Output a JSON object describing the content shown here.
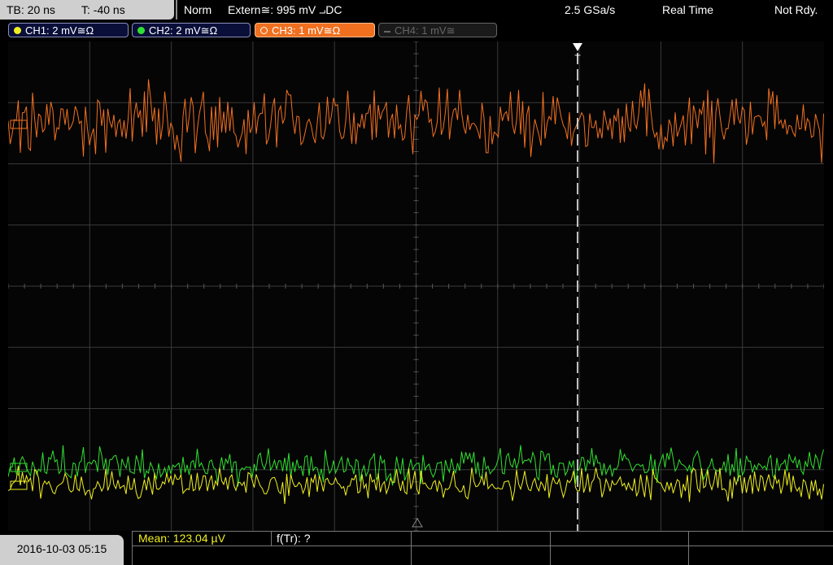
{
  "header": {
    "tb_label": "TB: 20 ns",
    "trig_offset": "T: -40 ns",
    "mode": "Norm",
    "trigger": "Extern≅: 995 mV ⨼DC",
    "sample_rate": "2.5 GSa/s",
    "acq_mode": "Real Time",
    "status": "Not Rdy."
  },
  "channels": [
    {
      "label": "CH1: 2 mV≅Ω",
      "color": "#f0f020",
      "state": "on"
    },
    {
      "label": "CH2: 2 mV≅Ω",
      "color": "#30e030",
      "state": "on"
    },
    {
      "label": "CH3: 1 mV≅Ω",
      "color": "#f07020",
      "state": "active"
    },
    {
      "label": "CH4: 1 mV≅",
      "color": "#666666",
      "state": "off"
    }
  ],
  "trigger_marker": "T",
  "measurements": {
    "mean": "Mean: 123.04 µV",
    "freq": "f(Tr): ?"
  },
  "datetime": "2016-10-03 05:15",
  "colors": {
    "ch1": "#f0f020",
    "ch2": "#30e030",
    "ch3": "#f07020",
    "grid": "#3a3a3a"
  }
}
